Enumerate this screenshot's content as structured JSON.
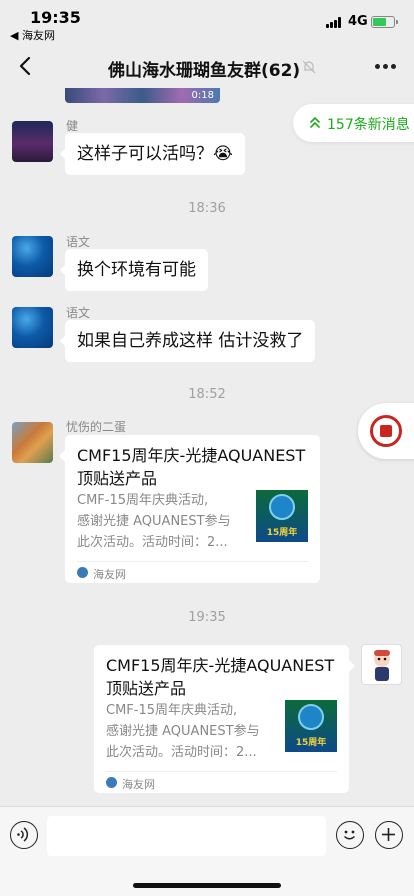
{
  "status_bar": {
    "time": "19:35",
    "back_app": "◀ 海友网",
    "network": "4G",
    "battery_icon": "battery-charging-icon"
  },
  "nav": {
    "title": "佛山海水珊瑚鱼友群(62)",
    "back_icon": "chevron-left-icon",
    "mute_icon": "mute-bell-icon",
    "more_icon": "more-dots-icon"
  },
  "chat": {
    "video_duration": "0:18",
    "new_messages": "157条新消息",
    "messages": [
      {
        "sender": "健",
        "text": "这样子可以活吗？😭",
        "avatar": "avatar-ferris-wheel"
      },
      {
        "timestamp": "18:36"
      },
      {
        "sender": "语文",
        "text": "换个环境有可能",
        "avatar": "avatar-ocean"
      },
      {
        "sender": "语文",
        "text": "如果自己养成这样 估计没救了",
        "avatar": "avatar-ocean"
      },
      {
        "timestamp": "18:52"
      },
      {
        "sender": "忧伤的二蛋",
        "avatar": "avatar-fish",
        "card": {
          "title": "CMF15周年庆-光捷AQUANEST顶贴送产品",
          "desc_lines": [
            "CMF-15周年庆典活动,",
            "感谢光捷 AQUANEST参与",
            "此次活动。活动时间：2..."
          ],
          "thumb_badge": "15周年",
          "source": "海友网"
        }
      },
      {
        "timestamp": "19:35"
      },
      {
        "sender": "",
        "avatar": "avatar-me",
        "card": {
          "title": "CMF15周年庆-光捷AQUANEST顶贴送产品",
          "desc_lines": [
            "CMF-15周年庆典活动,",
            "感谢光捷 AQUANEST参与",
            "此次活动。活动时间：2..."
          ],
          "thumb_badge": "15周年",
          "source": "海友网"
        }
      }
    ]
  },
  "input_bar": {
    "placeholder": "",
    "voice_icon": "voice-icon",
    "emoji_icon": "emoji-icon",
    "plus_icon": "plus-icon"
  },
  "colors": {
    "background": "#ededed",
    "accent_green": "#1aad19",
    "bubble": "#ffffff"
  }
}
